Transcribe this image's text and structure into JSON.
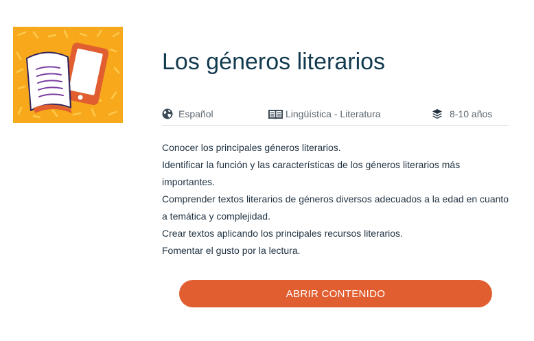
{
  "thumbnail": {
    "icon": "book-and-tablet-illustration",
    "background_color": "#f8a81b",
    "accent_color": "#e05e30"
  },
  "title": "Los géneros literarios",
  "meta": {
    "language": {
      "icon": "globe-icon",
      "label": "Español"
    },
    "subject": {
      "icon": "open-book-icon",
      "label": "Lingüística - Literatura"
    },
    "age": {
      "icon": "layers-icon",
      "label": "8-10 años"
    }
  },
  "objectives": [
    "Conocer los principales géneros literarios.",
    "Identificar la función y las características de los géneros literarios más",
    "importantes.",
    "Comprender textos literarios de géneros diversos adecuados a la edad en cuanto",
    "a temática y complejidad.",
    "Crear textos aplicando los principales recursos literarios.",
    "Fomentar el gusto por la lectura."
  ],
  "open_button": {
    "label": "ABRIR CONTENIDO",
    "color": "#e05e30"
  }
}
